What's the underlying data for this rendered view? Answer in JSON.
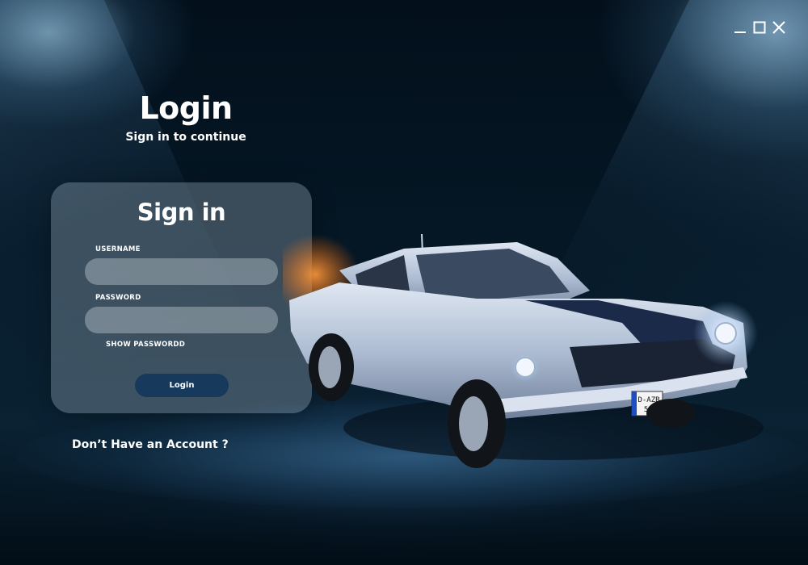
{
  "window": {
    "minimize_icon": "minimize-icon",
    "maximize_icon": "maximize-icon",
    "close_icon": "close-icon"
  },
  "header": {
    "title": "Login",
    "subtitle": "Sign in to continue"
  },
  "form": {
    "title": "Sign in",
    "username_label": "USERNAME",
    "username_value": "",
    "password_label": "PASSWORD",
    "password_value": "",
    "show_password_label": "SHOW PASSWORDD",
    "login_button": "Login"
  },
  "footer": {
    "signup_link": "Don’t Have an Account ?"
  },
  "hero": {
    "plate_line1": "D-AZB",
    "plate_line2": "530"
  },
  "colors": {
    "background": "#020d16",
    "card": "#aabecd",
    "button": "#173a5c",
    "text": "#ffffff",
    "car_body": "#b8c7dc",
    "car_stripe": "#1c2a4a"
  }
}
